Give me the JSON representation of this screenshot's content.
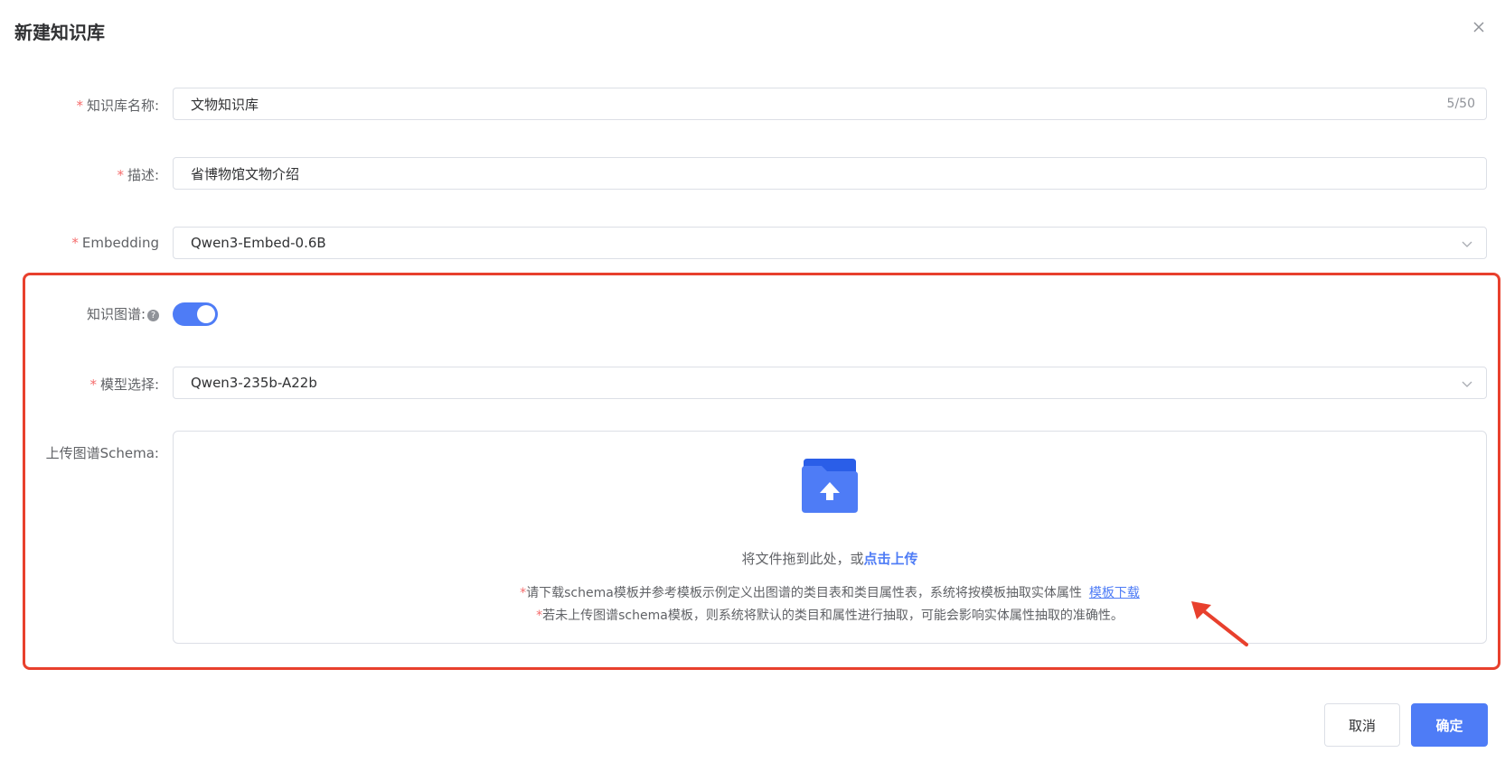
{
  "dialog": {
    "title": "新建知识库",
    "close_icon": "close-icon"
  },
  "form": {
    "name": {
      "label": "知识库名称:",
      "required": "*",
      "value": "文物知识库",
      "counter": "5/50"
    },
    "description": {
      "label": "描述:",
      "required": "*",
      "value": "省博物馆文物介绍"
    },
    "embedding": {
      "label": "Embedding",
      "required": "*",
      "value": "Qwen3-Embed-0.6B",
      "icon": "chevron-down-icon"
    },
    "knowledge_graph": {
      "label": "知识图谱:",
      "help": "?",
      "help_icon": "question-circle-icon",
      "enabled": true
    },
    "model": {
      "label": "模型选择:",
      "required": "*",
      "value": "Qwen3-235b-A22b",
      "icon": "chevron-down-icon"
    },
    "schema_upload": {
      "label": "上传图谱Schema:",
      "icon": "folder-upload-icon",
      "drag_text": "将文件拖到此处，或",
      "click_upload": "点击上传",
      "hint1_star": "*",
      "hint1": "请下载schema模板并参考模板示例定义出图谱的类目表和类目属性表，系统将按模板抽取实体属性",
      "download_link": "模板下载",
      "hint2_star": "*",
      "hint2": "若未上传图谱schema模板，则系统将默认的类目和属性进行抽取，可能会影响实体属性抽取的准确性。"
    }
  },
  "footer": {
    "cancel_label": "取消",
    "confirm_label": "确定"
  },
  "colors": {
    "primary": "#4e7cf6",
    "required": "#f56c6c",
    "highlight": "#e8402d"
  }
}
